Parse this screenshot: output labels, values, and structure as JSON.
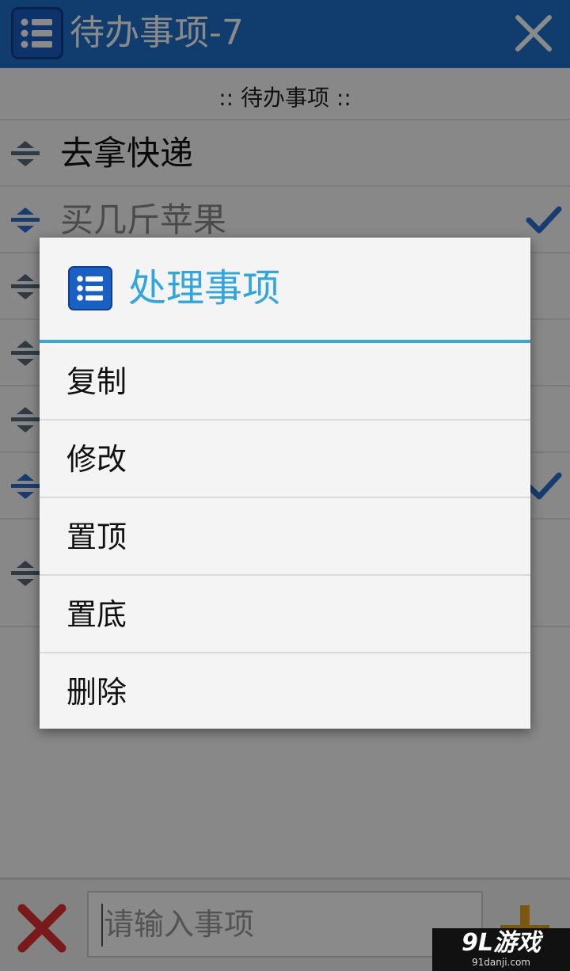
{
  "titlebar": {
    "title": "待办事项-7",
    "app_icon": "list-icon",
    "close_icon": "close-icon",
    "color": "#1f6fcb"
  },
  "subheader": {
    "text": ":: 待办事项 ::"
  },
  "rows": [
    {
      "text": "去拿快递",
      "done": false
    },
    {
      "text": "买几斤苹果",
      "done": true
    },
    {
      "text": "",
      "done": false
    },
    {
      "text": "",
      "done": false
    },
    {
      "text": "",
      "done": false
    },
    {
      "text": "",
      "done": true
    },
    {
      "text": "",
      "done": false
    }
  ],
  "bottombar": {
    "input_placeholder": "请输入事项",
    "cancel_icon": "cancel-x-icon",
    "add_icon": "add-plus-icon"
  },
  "dialog": {
    "title": "处理事项",
    "title_color": "#32a6dc",
    "items": [
      "复制",
      "修改",
      "置顶",
      "置底",
      "删除"
    ]
  },
  "watermark": {
    "main": "9L游戏",
    "sub": "91danji.com"
  }
}
